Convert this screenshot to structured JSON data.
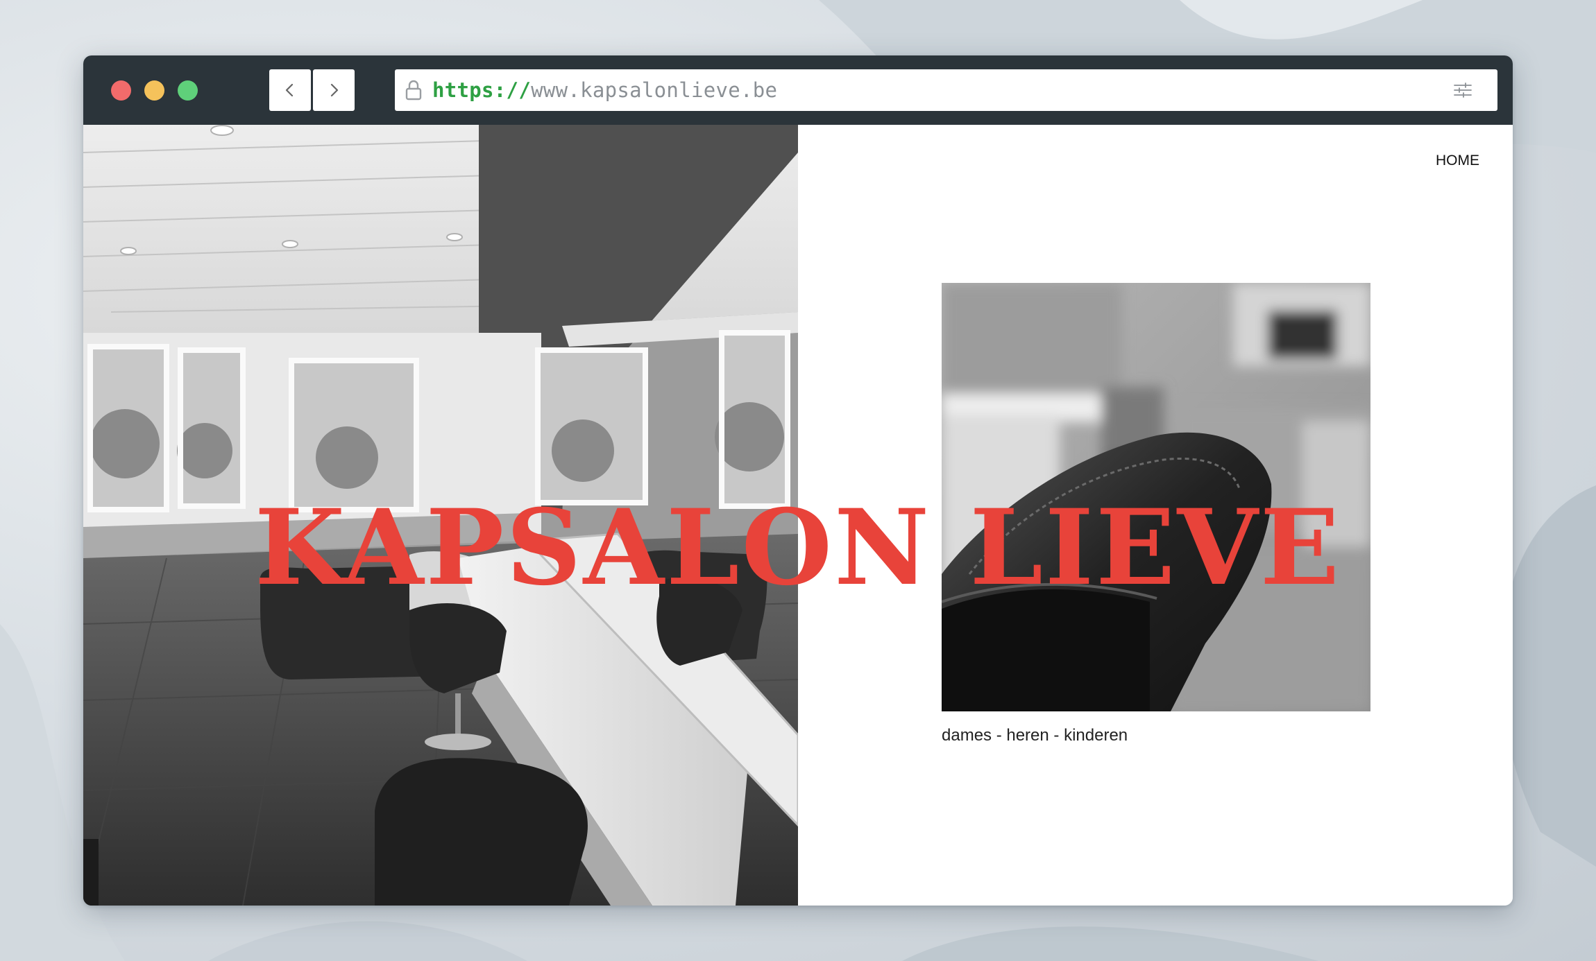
{
  "browser": {
    "url_scheme": "https://",
    "url_host": "www.kapsalonlieve.be",
    "icons": {
      "back": "chevron-left-icon",
      "forward": "chevron-right-icon",
      "lock": "lock-icon",
      "menu": "sliders-icon"
    }
  },
  "nav": {
    "home_label": "HOME"
  },
  "hero": {
    "title": "KAPSALON LIEVE",
    "tagline": "dames - heren - kinderen"
  },
  "colors": {
    "title_red": "#e8433a",
    "titlebar": "#2b343a",
    "traffic_red": "#f26b6b",
    "traffic_yellow": "#f5c25b",
    "traffic_green": "#5fd07a",
    "url_scheme_green": "#2ea043"
  }
}
